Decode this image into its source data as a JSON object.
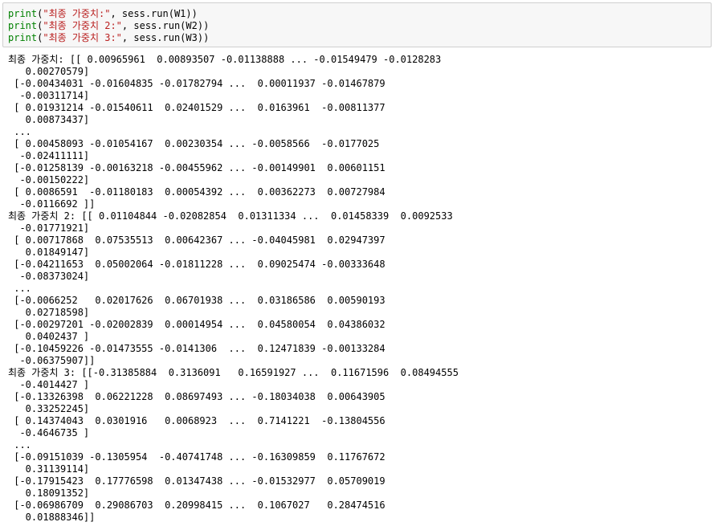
{
  "input_cell": {
    "lines": [
      {
        "fn": "print",
        "open": "(",
        "str": "\"최종 가중치:\"",
        "rest": ", sess.run(W1)",
        "close": ")"
      },
      {
        "fn": "print",
        "open": "(",
        "str": "\"최종 가중치 2:\"",
        "rest": ", sess.run(W2)",
        "close": ")"
      },
      {
        "fn": "print",
        "open": "(",
        "str": "\"최종 가중치 3:\"",
        "rest": ", sess.run(W3)",
        "close": ")"
      }
    ]
  },
  "output": {
    "lines": [
      "최종 가중치: [[ 0.00965961  0.00893507 -0.01138888 ... -0.01549479 -0.0128283",
      "   0.00270579]",
      " [-0.00434031 -0.01604835 -0.01782794 ...  0.00011937 -0.01467879",
      "  -0.00311714]",
      " [ 0.01931214 -0.01540611  0.02401529 ...  0.0163961  -0.00811377",
      "   0.00873437]",
      " ...",
      " [ 0.00458093 -0.01054167  0.00230354 ... -0.0058566  -0.0177025",
      "  -0.02411111]",
      " [-0.01258139 -0.00163218 -0.00455962 ... -0.00149901  0.00601151",
      "  -0.00150222]",
      " [ 0.0086591  -0.01180183  0.00054392 ...  0.00362273  0.00727984",
      "  -0.0116692 ]]",
      "최종 가중치 2: [[ 0.01104844 -0.02082854  0.01311334 ...  0.01458339  0.0092533",
      "  -0.01771921]",
      " [ 0.00717868  0.07535513  0.00642367 ... -0.04045981  0.02947397",
      "   0.01849147]",
      " [-0.04211653  0.05002064 -0.01811228 ...  0.09025474 -0.00333648",
      "  -0.08373024]",
      " ...",
      " [-0.0066252   0.02017626  0.06701938 ...  0.03186586  0.00590193",
      "   0.02718598]",
      " [-0.00297201 -0.02002839  0.00014954 ...  0.04580054  0.04386032",
      "   0.0402437 ]",
      " [-0.10459226 -0.01473555 -0.0141306  ...  0.12471839 -0.00133284",
      "  -0.06375907]]",
      "최종 가중치 3: [[-0.31385884  0.3136091   0.16591927 ...  0.11671596  0.08494555",
      "  -0.4014427 ]",
      " [-0.13326398  0.06221228  0.08697493 ... -0.18034038  0.00643905",
      "   0.33252245]",
      " [ 0.14374043  0.0301916   0.0068923  ...  0.7141221  -0.13804556",
      "  -0.4646735 ]",
      " ...",
      " [-0.09151039 -0.1305954  -0.40741748 ... -0.16309859  0.11767672",
      "   0.31139114]",
      " [-0.17915423  0.17776598  0.01347438 ... -0.01532977  0.05709019",
      "   0.18091352]",
      " [-0.06986709  0.29086703  0.20998415 ...  0.1067027   0.28474516",
      "   0.01888346]]"
    ]
  },
  "colors": {
    "keyword": "#008000",
    "string": "#ba2121",
    "cell_background": "#f7f7f7",
    "cell_border": "#cfcfcf"
  }
}
